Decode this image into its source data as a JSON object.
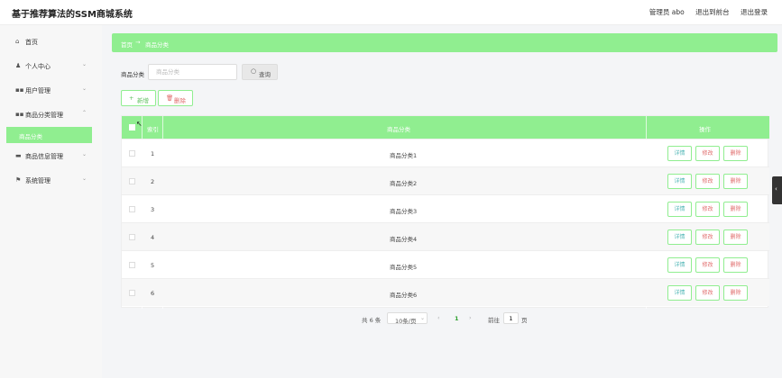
{
  "header": {
    "title": "基于推荐算法的SSM商城系统",
    "user": "管理员 abo",
    "to_front": "退出到前台",
    "logout": "退出登录"
  },
  "sidebar": {
    "items": [
      {
        "label": "首页",
        "icon": "home-icon",
        "has_arrow": false
      },
      {
        "label": "个人中心",
        "icon": "user-icon",
        "has_arrow": true
      },
      {
        "label": "用户管理",
        "icon": "grid-icon",
        "has_arrow": true
      },
      {
        "label": "商品分类管理",
        "icon": "grid-icon",
        "has_arrow": true
      },
      {
        "label": "商品信息管理",
        "icon": "box-icon",
        "has_arrow": true
      },
      {
        "label": "系统管理",
        "icon": "flag-icon",
        "has_arrow": true
      }
    ],
    "active_sub": "商品分类"
  },
  "breadcrumb": {
    "home": "首页",
    "separator": "→",
    "current": "商品分类"
  },
  "search": {
    "label": "商品分类",
    "placeholder": "商品分类",
    "value": "",
    "button": "查询"
  },
  "actions": {
    "add": "新增",
    "delete": "删除"
  },
  "table": {
    "headers": {
      "index": "索引",
      "category": "商品分类",
      "operations": "操作"
    },
    "rows": [
      {
        "index": "1",
        "category": "商品分类1"
      },
      {
        "index": "2",
        "category": "商品分类2"
      },
      {
        "index": "3",
        "category": "商品分类3"
      },
      {
        "index": "4",
        "category": "商品分类4"
      },
      {
        "index": "5",
        "category": "商品分类5"
      },
      {
        "index": "6",
        "category": "商品分类6"
      }
    ],
    "row_actions": {
      "detail": "详情",
      "edit": "修改",
      "delete": "删除"
    }
  },
  "pagination": {
    "total": "共 6 条",
    "page_size": "10条/页",
    "current_page": "1",
    "goto_label": "前往",
    "goto_value": "1",
    "goto_unit": "页"
  },
  "colors": {
    "accent": "#90ee90",
    "sidebar_bg": "#f7f7f7",
    "page_bg": "#f4f5f7"
  }
}
